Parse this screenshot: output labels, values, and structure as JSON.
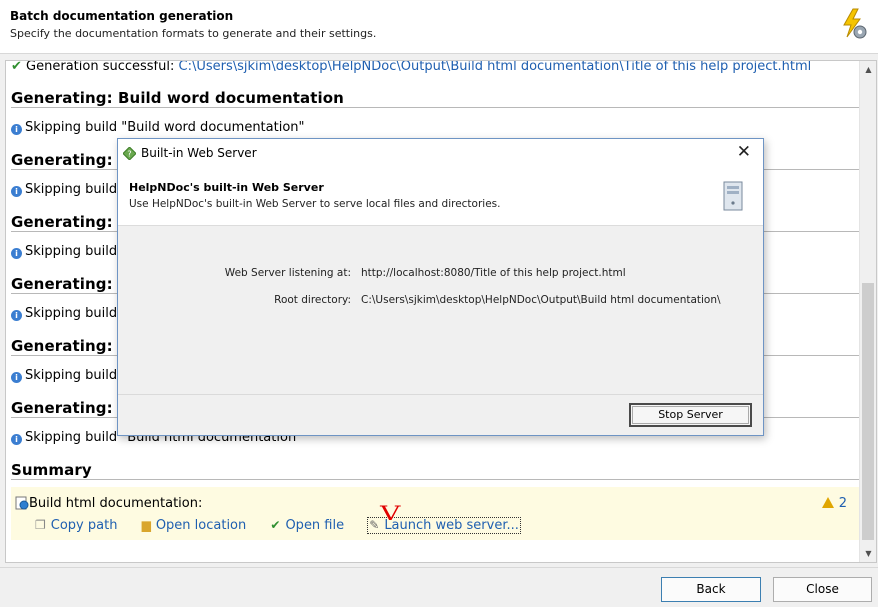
{
  "header": {
    "title": "Batch documentation generation",
    "subtitle": "Specify the documentation formats to generate and their settings."
  },
  "log": {
    "success_prefix": "Generation successful: ",
    "success_path": "C:\\Users\\sjkim\\desktop\\HelpNDoc\\Output\\Build html documentation\\Title of this help project.html",
    "sections": [
      {
        "heading": "Generating: Build word documentation",
        "line": "Skipping build \"Build word documentation\""
      },
      {
        "heading": "Generating: Bu",
        "line": "Skipping build \""
      },
      {
        "heading": "Generating: Bu",
        "line": "Skipping build \""
      },
      {
        "heading": "Generating: Bu",
        "line": "Skipping build \""
      },
      {
        "heading": "Generating: Bu",
        "line": "Skipping build \""
      },
      {
        "heading": "Generating: Bu",
        "line": "Skipping build \"Build html documentation\""
      }
    ],
    "summary_heading": "Summary"
  },
  "summary": {
    "title": "Build html documentation:",
    "warning_count": "2",
    "actions": {
      "copy_path": "Copy path",
      "open_location": "Open location",
      "open_file": "Open file",
      "launch_web_server": "Launch web server..."
    },
    "annotation": "V"
  },
  "footer": {
    "back": "Back",
    "close": "Close"
  },
  "dialog": {
    "title": "Built-in Web Server",
    "close_glyph": "✕",
    "heading": "HelpNDoc's built-in Web Server",
    "description": "Use HelpNDoc's built-in Web Server to serve local files and directories.",
    "listening_label": "Web Server listening at:",
    "listening_value": "http://localhost:8080/Title of this help project.html",
    "root_label": "Root directory:",
    "root_value": "C:\\Users\\sjkim\\desktop\\HelpNDoc\\Output\\Build html documentation\\",
    "stop_button": "Stop Server"
  },
  "icons": {
    "header": "lightning-gear-icon",
    "dialog": "web-server-icon",
    "server": "server-tower-icon"
  },
  "colors": {
    "link": "#1f5fb0",
    "summary_bg": "#fefbe1",
    "annotation": "#e00000"
  }
}
